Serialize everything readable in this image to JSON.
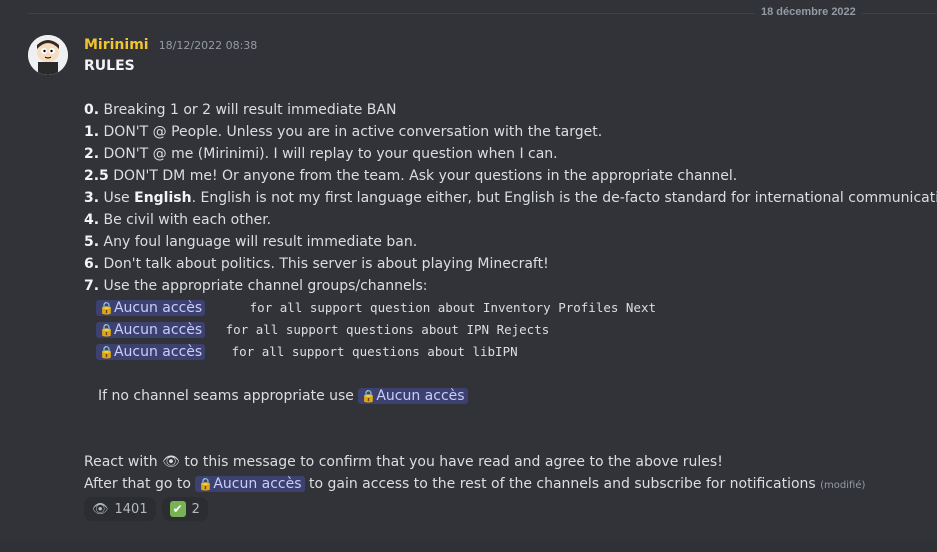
{
  "date_divider": "18 décembre 2022",
  "message": {
    "author": "Mirinimi",
    "timestamp": "18/12/2022 08:38",
    "title": "RULES",
    "rules": [
      {
        "num": "0.",
        "text": " Breaking 1 or 2 will result immediate BAN"
      },
      {
        "num": "1.",
        "text": " DON'T @ People. Unless you are in active conversation with the target."
      },
      {
        "num": "2.",
        "text": " DON'T @ me (Mirinimi). I will replay to your question when I can."
      },
      {
        "num": "2.5",
        "text": " DON'T DM me! Or anyone from the team. Ask your questions in the appropriate channel."
      },
      {
        "num": "3.",
        "text_pre": " Use ",
        "bold": "English",
        "text_post": ". English is not my first language either, but English is the de-facto standard for international communication."
      },
      {
        "num": "4.",
        "text": " Be civil with each other."
      },
      {
        "num": "5.",
        "text": " Any foul language will result immediate ban."
      },
      {
        "num": "6.",
        "text": " Don't talk about politics. This server is about playing Minecraft!"
      },
      {
        "num": "7.",
        "text": " Use the appropriate channel groups/channels:"
      }
    ],
    "channels": [
      {
        "mention": "Aucun accès",
        "desc": "for all support question about Inventory Profiles Next"
      },
      {
        "mention": "Aucun accès",
        "desc": "for all support questions about IPN Rejects"
      },
      {
        "mention": "Aucun accès",
        "desc": "for all support questions about libIPN"
      }
    ],
    "fallback_pre": "If no channel seams appropriate use ",
    "fallback_mention": "Aucun accès",
    "react_pre": "React with ",
    "react_post": " to this message to confirm that you have read and agree to the above rules!",
    "after_pre": "After that go to ",
    "after_mention": "Aucun accès",
    "after_post": " to gain access to the rest of the channels and subscribe for notifications ",
    "edited": "(modifié)"
  },
  "reactions": [
    {
      "emoji": "eye-emoji",
      "count": "1401"
    },
    {
      "emoji": "check-emoji",
      "count": "2"
    }
  ],
  "colors": {
    "author": "#f0c330",
    "mention_bg": "#3c4270",
    "background": "#313338"
  }
}
